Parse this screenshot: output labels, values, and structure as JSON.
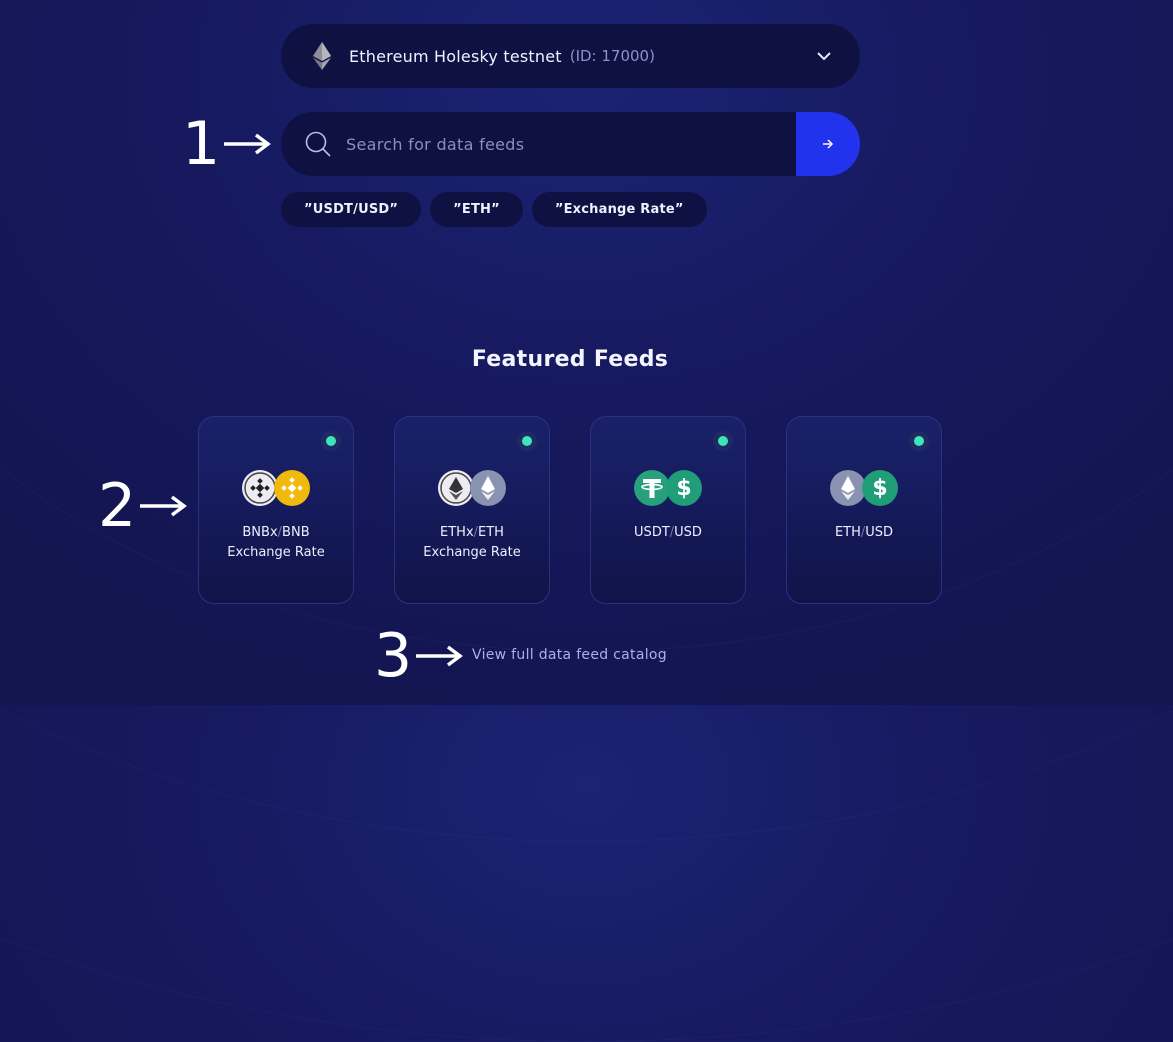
{
  "network": {
    "name": "Ethereum Holesky testnet",
    "id": "(ID: 17000)",
    "icon": "ethereum-icon"
  },
  "search": {
    "placeholder": "Search for data feeds",
    "submit_icon": "arrow-right-icon",
    "accent": "#2233ee"
  },
  "suggestions": [
    "”USDT/USD”",
    "”ETH”",
    "”Exchange Rate”"
  ],
  "annotations": [
    "1",
    "2",
    "3"
  ],
  "featured": {
    "title": "Featured Feeds",
    "feeds": [
      {
        "base": "BNBx",
        "quote": "BNB",
        "subtitle": "Exchange Rate",
        "icons": [
          "bnbx-icon",
          "bnb-icon"
        ]
      },
      {
        "base": "ETHx",
        "quote": "ETH",
        "subtitle": "Exchange Rate",
        "icons": [
          "ethx-icon",
          "ethereum-icon"
        ]
      },
      {
        "base": "USDT",
        "quote": "USD",
        "subtitle": "",
        "icons": [
          "tether-icon",
          "dollar-icon"
        ]
      },
      {
        "base": "ETH",
        "quote": "USD",
        "subtitle": "",
        "icons": [
          "ethereum-icon",
          "dollar-icon"
        ]
      }
    ],
    "status_color": "#3ce6b8"
  },
  "catalog_link": "View full data feed catalog"
}
